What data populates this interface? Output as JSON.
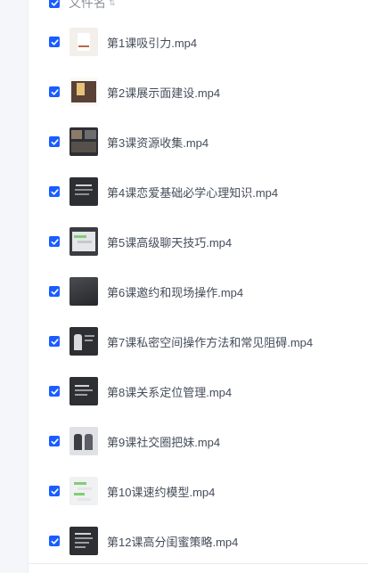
{
  "header": {
    "column_label": "文件名",
    "select_all_checked": true
  },
  "files": [
    {
      "name": "第1课吸引力.mp4",
      "checked": true
    },
    {
      "name": "第2课展示面建设.mp4",
      "checked": true
    },
    {
      "name": "第3课资源收集.mp4",
      "checked": true
    },
    {
      "name": "第4课恋爱基础必学心理知识.mp4",
      "checked": true
    },
    {
      "name": "第5课高级聊天技巧.mp4",
      "checked": true
    },
    {
      "name": "第6课邀约和现场操作.mp4",
      "checked": true
    },
    {
      "name": "第7课私密空间操作方法和常见阻碍.mp4",
      "checked": true
    },
    {
      "name": "第8课关系定位管理.mp4",
      "checked": true
    },
    {
      "name": "第9课社交圈把妹.mp4",
      "checked": true
    },
    {
      "name": "第10课速约模型.mp4",
      "checked": true
    },
    {
      "name": "第12课高分闺蜜策略.mp4",
      "checked": true
    }
  ],
  "colors": {
    "accent": "#1a5dff",
    "text": "#454d5a",
    "header_text": "#8a8f99"
  }
}
